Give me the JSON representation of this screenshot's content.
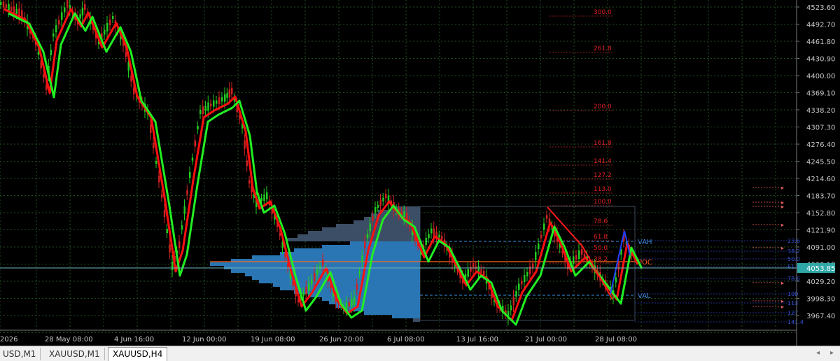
{
  "chart": {
    "symbol": "XAUUSD,H4",
    "current_price": "4053.85",
    "colors": {
      "background": "#000000",
      "grid": "#1f4f1f",
      "axis_text": "#c8c8c8",
      "candle_up": "#22cc22",
      "candle_down": "#cc2222",
      "ma_fast": "#ff1010",
      "ma_slow": "#22ee22",
      "price_tag": "#2fa7a7",
      "volume_profile": "#2a76b4",
      "fib_text": "#e02020",
      "vah_val_text": "#3a8fe0",
      "poc_text": "#ff5a1e"
    },
    "price_axis_labels": [
      "4523.60",
      "4492.70",
      "4461.80",
      "4430.90",
      "4400.00",
      "4369.10",
      "4338.20",
      "4307.30",
      "4276.40",
      "4245.50",
      "4214.60",
      "4183.70",
      "4152.80",
      "4121.90",
      "4091.00",
      "4060.10",
      "4029.20",
      "3998.30",
      "3967.40"
    ],
    "time_axis_labels": [
      "2026",
      "28 May 08:00",
      "4 Jun 16:00",
      "12 Jun 00:00",
      "19 Jun 08:00",
      "26 Jun 20:00",
      "6 Jul 08:00",
      "13 Jul 16:00",
      "21 Jul 00:00",
      "28 Jul 08:00"
    ],
    "fib_levels": [
      "300.0",
      "261.8",
      "200.0",
      "161.8",
      "141.4",
      "127.2",
      "113.0",
      "100.0",
      "78.6",
      "61.8",
      "50.0",
      "38.2"
    ],
    "profile_labels": {
      "vah": "VAH",
      "poc": "POC",
      "val": "VAL"
    },
    "right_level_labels": [
      "23.6",
      "38.2",
      "50.0",
      "61.8",
      "78.6",
      "100",
      "113",
      "127",
      "141.4"
    ]
  },
  "tabs": [
    {
      "label": "USD,M1",
      "active": false
    },
    {
      "label": "XAUUSD,M1",
      "active": false
    },
    {
      "label": "XAUUSD,H4",
      "active": true
    }
  ],
  "nav": {
    "left": "◂",
    "right": "▸"
  }
}
